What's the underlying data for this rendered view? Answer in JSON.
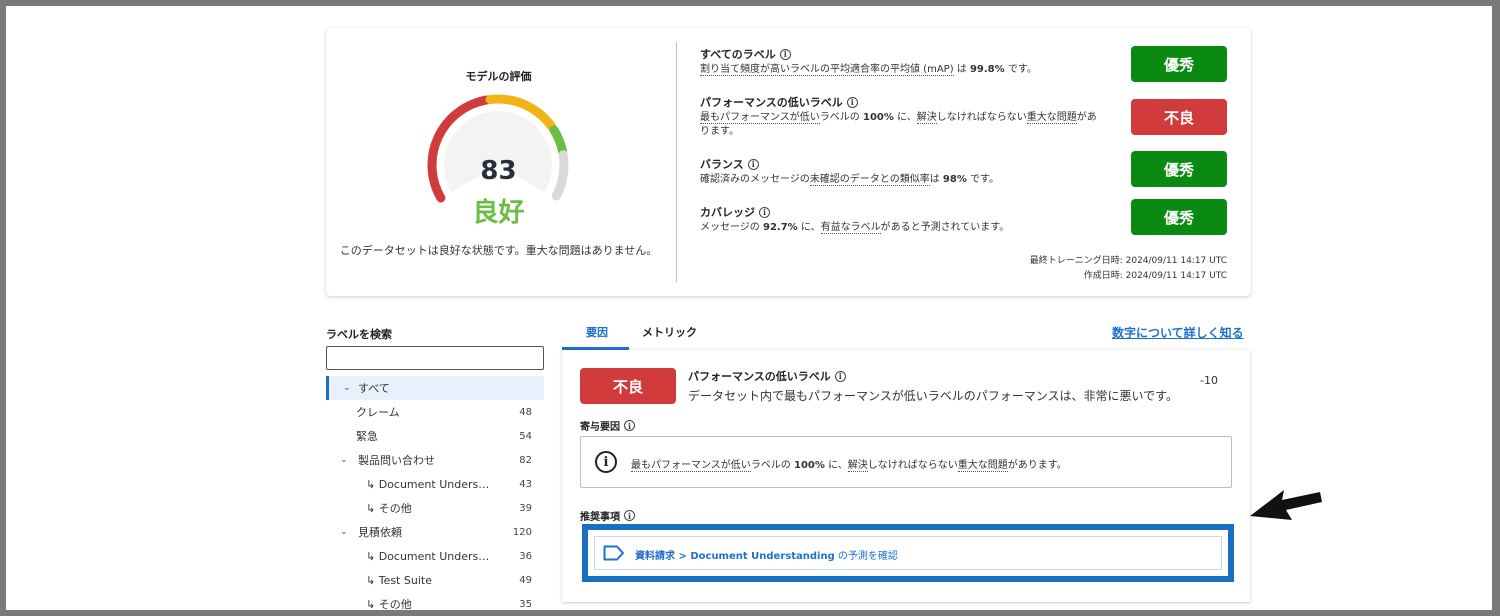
{
  "gauge": {
    "title": "モデルの評価",
    "score": "83",
    "grade": "良好",
    "description": "このデータセットは良好な状態です。重大な問題はありません。",
    "colors": {
      "bad": "#d23b3b",
      "mid": "#f2b21a",
      "good": "#6cbd45",
      "empty": "#d9d9d9"
    }
  },
  "metrics": [
    {
      "title": "すべてのラベル",
      "desc_parts": [
        "割り当て頻度が高いラベルの平均適合率の平均値 (mAP)",
        " は ",
        "99.8%",
        " です。"
      ],
      "grade": "優秀"
    },
    {
      "title": "パフォーマンスの低いラベル",
      "desc_line1": [
        "最もパフォーマンスが低い",
        "ラベルの ",
        "100%",
        " に、",
        "解決",
        "しなければならない",
        "重大な問題",
        "があ"
      ],
      "desc_line2": "ります。",
      "grade": "不良"
    },
    {
      "title": "バランス",
      "desc_parts": [
        "確認済みのメッセージの",
        "未確認のデータとの類似率",
        "は ",
        "98%",
        " です。"
      ],
      "grade": "優秀"
    },
    {
      "title": "カバレッジ",
      "desc_parts": [
        "メッセージの ",
        "92.7%",
        " に、",
        "有益なラベル",
        "があると予測されています。"
      ],
      "grade": "優秀"
    }
  ],
  "timestamps": {
    "last_training": "最終トレーニング日時: 2024/09/11 14:17 UTC",
    "created": "作成日時: 2024/09/11 14:17 UTC"
  },
  "search": {
    "label": "ラベルを検索",
    "placeholder": ""
  },
  "tree": [
    {
      "label": "すべて",
      "count": "",
      "level": 0,
      "chevron": true,
      "selected": true
    },
    {
      "label": "クレーム",
      "count": "48",
      "level": 1,
      "chevron": false,
      "selected": false
    },
    {
      "label": "緊急",
      "count": "54",
      "level": 1,
      "chevron": false,
      "selected": false
    },
    {
      "label": "製品問い合わせ",
      "count": "82",
      "level": 0,
      "chevron": true,
      "selected": false
    },
    {
      "label": "↳ Document Understan...",
      "count": "43",
      "level": 2,
      "chevron": false,
      "selected": false
    },
    {
      "label": "↳ その他",
      "count": "39",
      "level": 2,
      "chevron": false,
      "selected": false
    },
    {
      "label": "見積依頼",
      "count": "120",
      "level": 0,
      "chevron": true,
      "selected": false
    },
    {
      "label": "↳ Document Understan...",
      "count": "36",
      "level": 2,
      "chevron": false,
      "selected": false
    },
    {
      "label": "↳ Test Suite",
      "count": "49",
      "level": 2,
      "chevron": false,
      "selected": false
    },
    {
      "label": "↳ その他",
      "count": "35",
      "level": 2,
      "chevron": false,
      "selected": false
    }
  ],
  "tabs": {
    "factors": "要因",
    "metrics": "メトリック"
  },
  "learn_more": "数字について詳しく知る",
  "factor": {
    "badge": "不良",
    "title": "パフォーマンスの低いラベル",
    "description": "データセット内で最もパフォーマンスが低いラベルのパフォーマンスは、非常に悪いです。",
    "score": "-10"
  },
  "contributing": {
    "title": "寄与要因",
    "text_parts": [
      "最もパフォーマンスが低い",
      "ラベルの ",
      "100%",
      " に、",
      "解決",
      "しなければならない",
      "重大な問題",
      "があります。"
    ]
  },
  "recommendations": {
    "title": "推奨事項",
    "link_bold": "資料請求 > Document Understanding",
    "link_plain": " の予測を確認"
  }
}
